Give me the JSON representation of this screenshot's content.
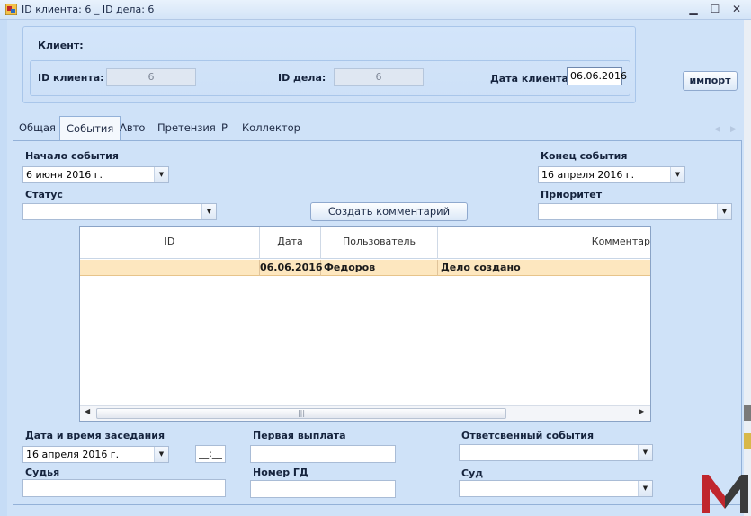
{
  "window": {
    "title": "ID клиента: 6 _ ID дела: 6",
    "buttons": [
      "minimize",
      "maximize",
      "close"
    ]
  },
  "client": {
    "section_label": "Клиент:",
    "client_id_label": "ID клиента:",
    "client_id_value": "6",
    "case_id_label": "ID дела:",
    "case_id_value": "6",
    "client_date_label": "Дата клиента:",
    "client_date_value": "06.06.2016"
  },
  "import_button": "импорт",
  "tabs": [
    {
      "label": "Общая",
      "active": false
    },
    {
      "label": "События",
      "active": true
    },
    {
      "label": "Авто",
      "active": false
    },
    {
      "label": "Претензия",
      "active": false
    },
    {
      "label": "Р",
      "active": false
    },
    {
      "label": "Коллектор",
      "active": false
    }
  ],
  "events": {
    "start_label": "Начало события",
    "start_value": "6 июня 2016 г.",
    "end_label": "Конец события",
    "end_value": "16 апреля 2016 г.",
    "status_label": "Статус",
    "status_value": "",
    "priority_label": "Приоритет",
    "priority_value": "",
    "create_comment_button": "Создать комментарий"
  },
  "grid": {
    "columns": [
      "ID",
      "Дата",
      "Пользователь",
      "Комментар"
    ],
    "rows": [
      {
        "id": "",
        "date": "06.06.2016",
        "user": "Федоров",
        "comment": "Дело создано"
      }
    ],
    "scroll_grip": "|||"
  },
  "hearing": {
    "datetime_label": "Дата и время заседания",
    "date_value": "16 апреля 2016 г.",
    "time_value": "__:__",
    "first_payment_label": "Первая выплата",
    "first_payment_value": "",
    "responsible_label": "Ответсвенный события",
    "responsible_value": "",
    "judge_label": "Судья",
    "judge_value": "",
    "gd_number_label": "Номер ГД",
    "gd_number_value": "",
    "court_label": "Суд",
    "court_value": ""
  },
  "icons": {
    "app": "app-icon",
    "dropdown": "chevron-down-icon",
    "scroll_left": "arrow-left-icon",
    "scroll_right": "arrow-right-icon",
    "logo": "logo-m-icon"
  },
  "colors": {
    "accent": "#cfe2f8",
    "selected_row": "#fde7bf",
    "logo_red": "#c0262d",
    "logo_dark": "#3b3b3b"
  }
}
